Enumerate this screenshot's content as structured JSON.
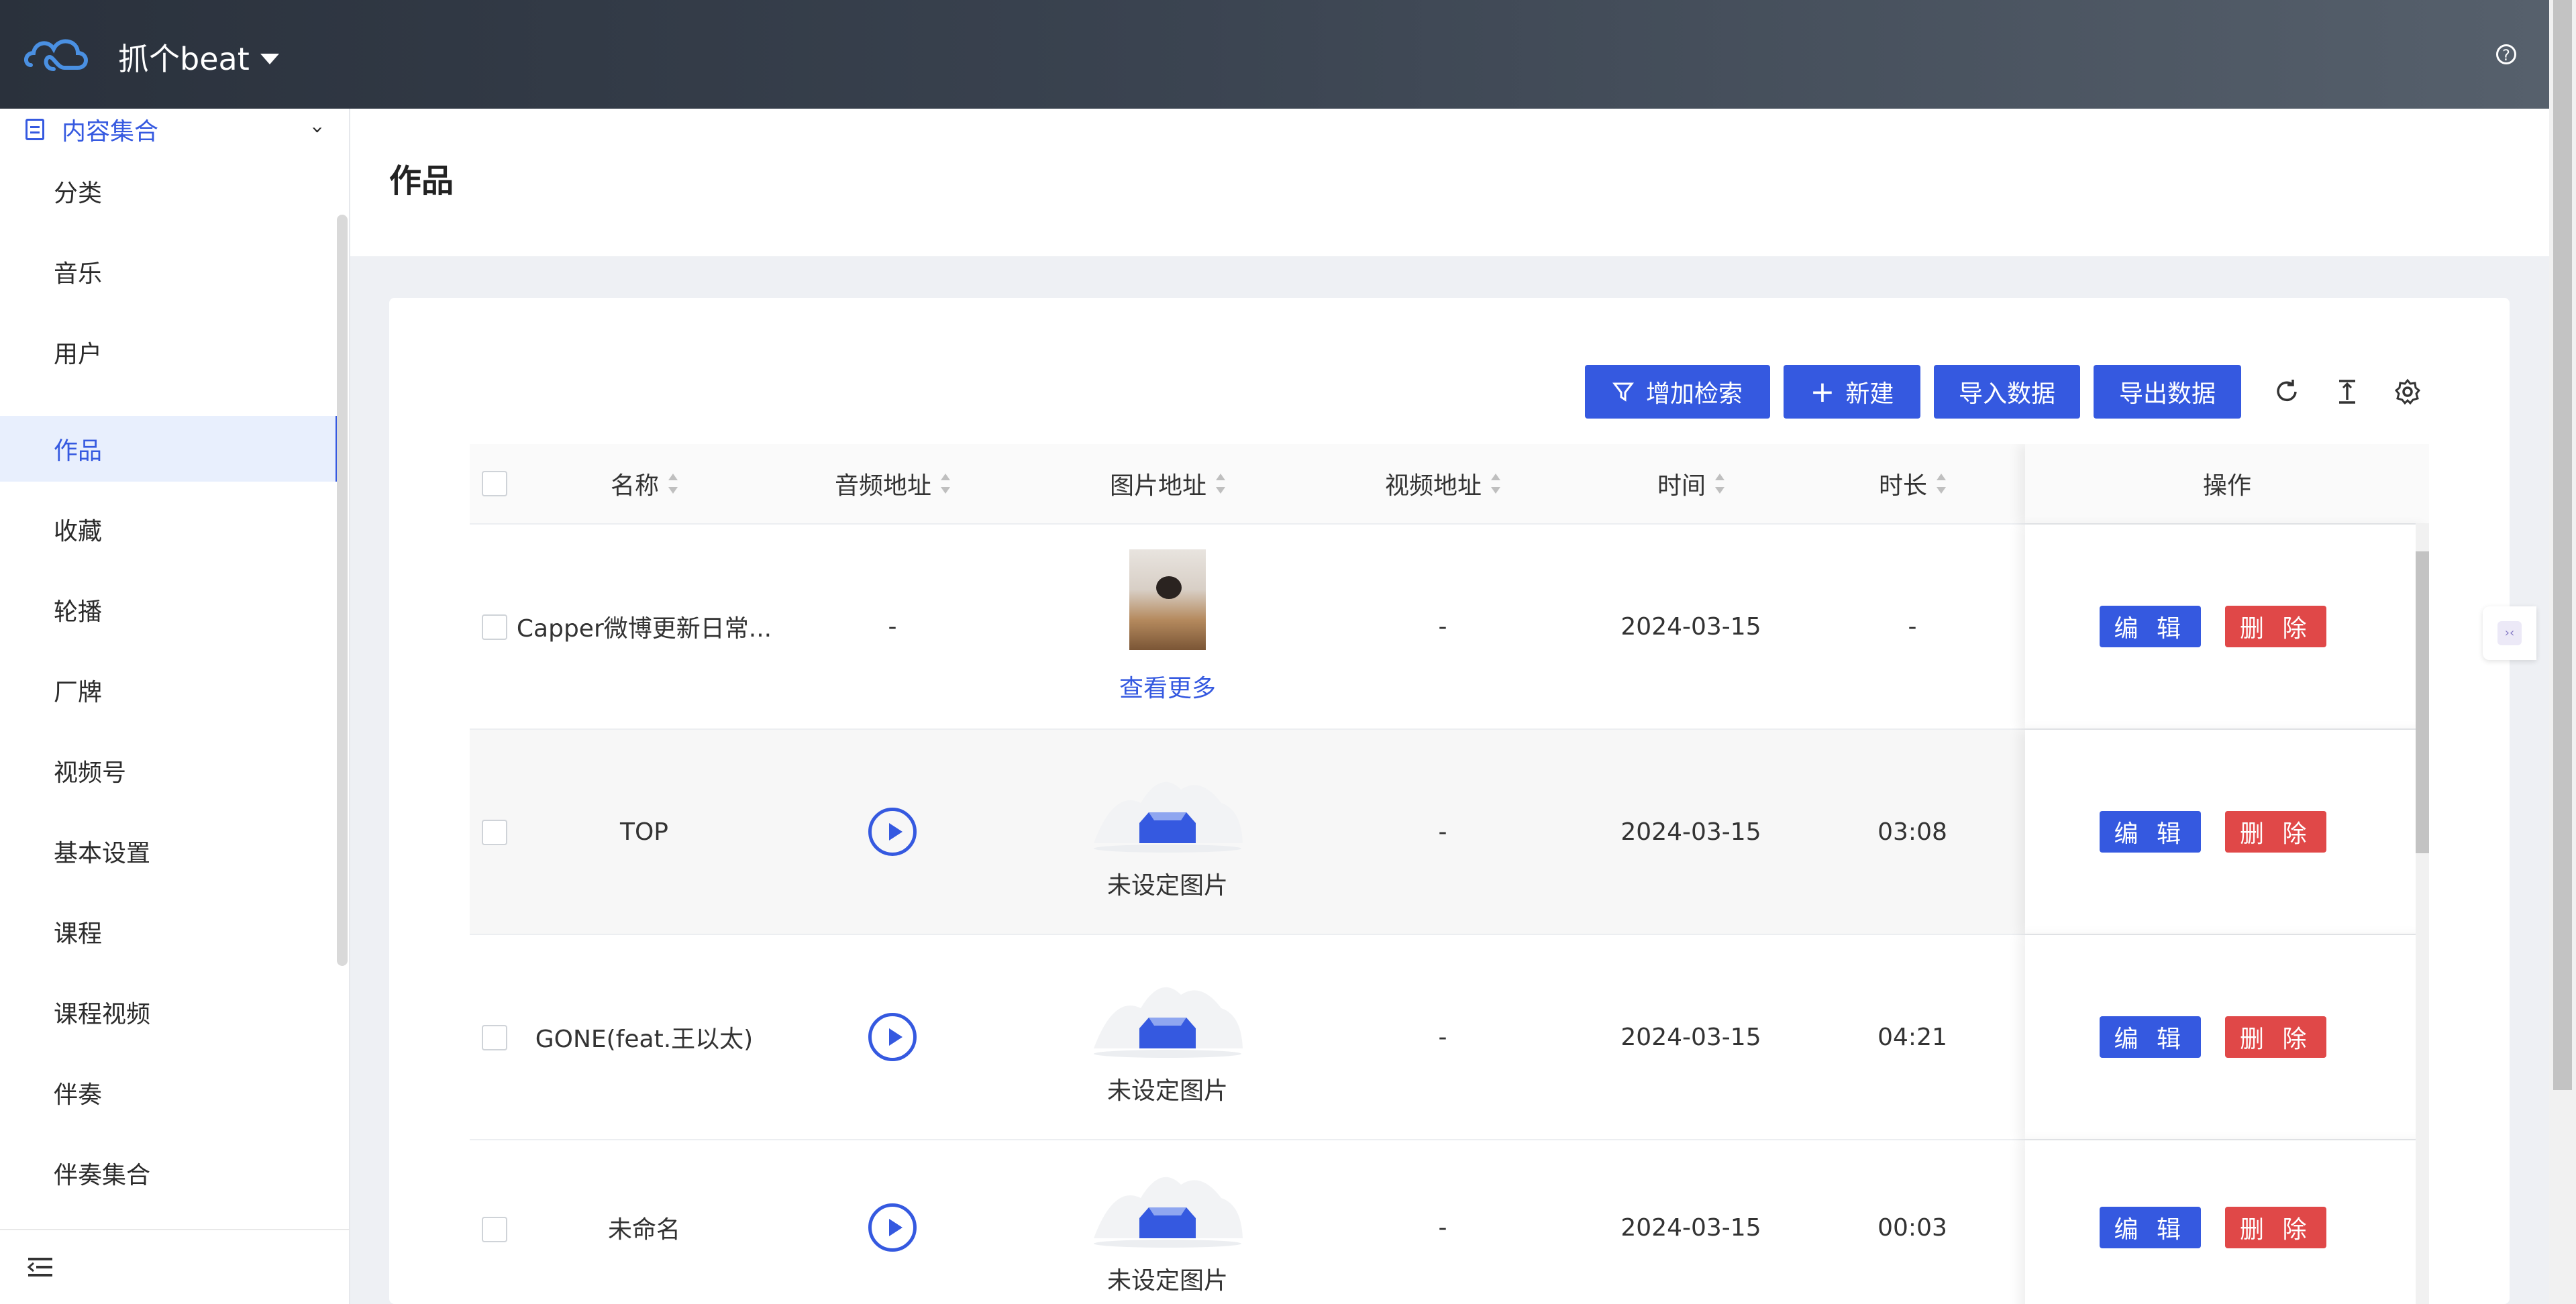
{
  "header": {
    "app_name": "抓个beat",
    "help_icon": "?"
  },
  "sidebar": {
    "group_label": "内容集合",
    "items": [
      "分类",
      "音乐",
      "用户",
      "作品",
      "收藏",
      "轮播",
      "厂牌",
      "视频号",
      "基本设置",
      "课程",
      "课程视频",
      "伴奏",
      "伴奏集合"
    ],
    "active": "作品"
  },
  "page": {
    "title": "作品"
  },
  "toolbar": {
    "search_label": "增加检索",
    "new_label": "新建",
    "import_label": "导入数据",
    "export_label": "导出数据"
  },
  "table": {
    "columns": [
      "名称",
      "音频地址",
      "图片地址",
      "视频地址",
      "时间",
      "时长",
      "操作"
    ],
    "rows": [
      {
        "name": "Capper微博更新日常...",
        "audio": "-",
        "image_link": "查看更多",
        "video": "-",
        "time": "2024-03-15",
        "duration": "-"
      },
      {
        "name": "TOP",
        "audio": "",
        "image_caption": "未设定图片",
        "video": "-",
        "time": "2024-03-15",
        "duration": "03:08"
      },
      {
        "name": "GONE(feat.王以太)",
        "audio": "",
        "image_caption": "未设定图片",
        "video": "-",
        "time": "2024-03-15",
        "duration": "04:21"
      },
      {
        "name": "未命名",
        "audio": "",
        "image_caption": "未设定图片",
        "video": "-",
        "time": "2024-03-15",
        "duration": "00:03"
      }
    ],
    "edit_label": "编 辑",
    "delete_label": "删 除"
  },
  "colors": {
    "primary": "#3559e0",
    "danger": "#e04848",
    "header_dark": "#2a313c"
  }
}
